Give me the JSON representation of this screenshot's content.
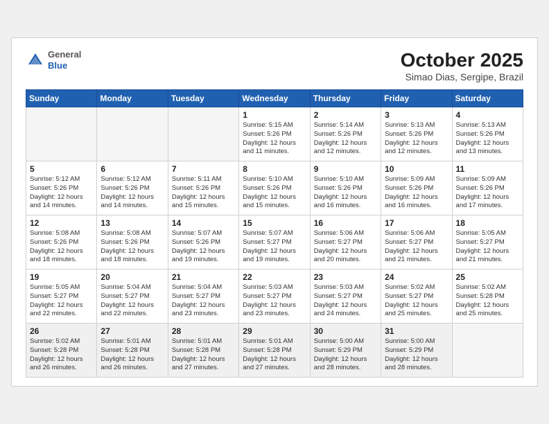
{
  "header": {
    "logo_general": "General",
    "logo_blue": "Blue",
    "month": "October 2025",
    "location": "Simao Dias, Sergipe, Brazil"
  },
  "days_of_week": [
    "Sunday",
    "Monday",
    "Tuesday",
    "Wednesday",
    "Thursday",
    "Friday",
    "Saturday"
  ],
  "weeks": [
    [
      {
        "day": "",
        "info": ""
      },
      {
        "day": "",
        "info": ""
      },
      {
        "day": "",
        "info": ""
      },
      {
        "day": "1",
        "info": "Sunrise: 5:15 AM\nSunset: 5:26 PM\nDaylight: 12 hours\nand 11 minutes."
      },
      {
        "day": "2",
        "info": "Sunrise: 5:14 AM\nSunset: 5:26 PM\nDaylight: 12 hours\nand 12 minutes."
      },
      {
        "day": "3",
        "info": "Sunrise: 5:13 AM\nSunset: 5:26 PM\nDaylight: 12 hours\nand 12 minutes."
      },
      {
        "day": "4",
        "info": "Sunrise: 5:13 AM\nSunset: 5:26 PM\nDaylight: 12 hours\nand 13 minutes."
      }
    ],
    [
      {
        "day": "5",
        "info": "Sunrise: 5:12 AM\nSunset: 5:26 PM\nDaylight: 12 hours\nand 14 minutes."
      },
      {
        "day": "6",
        "info": "Sunrise: 5:12 AM\nSunset: 5:26 PM\nDaylight: 12 hours\nand 14 minutes."
      },
      {
        "day": "7",
        "info": "Sunrise: 5:11 AM\nSunset: 5:26 PM\nDaylight: 12 hours\nand 15 minutes."
      },
      {
        "day": "8",
        "info": "Sunrise: 5:10 AM\nSunset: 5:26 PM\nDaylight: 12 hours\nand 15 minutes."
      },
      {
        "day": "9",
        "info": "Sunrise: 5:10 AM\nSunset: 5:26 PM\nDaylight: 12 hours\nand 16 minutes."
      },
      {
        "day": "10",
        "info": "Sunrise: 5:09 AM\nSunset: 5:26 PM\nDaylight: 12 hours\nand 16 minutes."
      },
      {
        "day": "11",
        "info": "Sunrise: 5:09 AM\nSunset: 5:26 PM\nDaylight: 12 hours\nand 17 minutes."
      }
    ],
    [
      {
        "day": "12",
        "info": "Sunrise: 5:08 AM\nSunset: 5:26 PM\nDaylight: 12 hours\nand 18 minutes."
      },
      {
        "day": "13",
        "info": "Sunrise: 5:08 AM\nSunset: 5:26 PM\nDaylight: 12 hours\nand 18 minutes."
      },
      {
        "day": "14",
        "info": "Sunrise: 5:07 AM\nSunset: 5:26 PM\nDaylight: 12 hours\nand 19 minutes."
      },
      {
        "day": "15",
        "info": "Sunrise: 5:07 AM\nSunset: 5:27 PM\nDaylight: 12 hours\nand 19 minutes."
      },
      {
        "day": "16",
        "info": "Sunrise: 5:06 AM\nSunset: 5:27 PM\nDaylight: 12 hours\nand 20 minutes."
      },
      {
        "day": "17",
        "info": "Sunrise: 5:06 AM\nSunset: 5:27 PM\nDaylight: 12 hours\nand 21 minutes."
      },
      {
        "day": "18",
        "info": "Sunrise: 5:05 AM\nSunset: 5:27 PM\nDaylight: 12 hours\nand 21 minutes."
      }
    ],
    [
      {
        "day": "19",
        "info": "Sunrise: 5:05 AM\nSunset: 5:27 PM\nDaylight: 12 hours\nand 22 minutes."
      },
      {
        "day": "20",
        "info": "Sunrise: 5:04 AM\nSunset: 5:27 PM\nDaylight: 12 hours\nand 22 minutes."
      },
      {
        "day": "21",
        "info": "Sunrise: 5:04 AM\nSunset: 5:27 PM\nDaylight: 12 hours\nand 23 minutes."
      },
      {
        "day": "22",
        "info": "Sunrise: 5:03 AM\nSunset: 5:27 PM\nDaylight: 12 hours\nand 23 minutes."
      },
      {
        "day": "23",
        "info": "Sunrise: 5:03 AM\nSunset: 5:27 PM\nDaylight: 12 hours\nand 24 minutes."
      },
      {
        "day": "24",
        "info": "Sunrise: 5:02 AM\nSunset: 5:27 PM\nDaylight: 12 hours\nand 25 minutes."
      },
      {
        "day": "25",
        "info": "Sunrise: 5:02 AM\nSunset: 5:28 PM\nDaylight: 12 hours\nand 25 minutes."
      }
    ],
    [
      {
        "day": "26",
        "info": "Sunrise: 5:02 AM\nSunset: 5:28 PM\nDaylight: 12 hours\nand 26 minutes."
      },
      {
        "day": "27",
        "info": "Sunrise: 5:01 AM\nSunset: 5:28 PM\nDaylight: 12 hours\nand 26 minutes."
      },
      {
        "day": "28",
        "info": "Sunrise: 5:01 AM\nSunset: 5:28 PM\nDaylight: 12 hours\nand 27 minutes."
      },
      {
        "day": "29",
        "info": "Sunrise: 5:01 AM\nSunset: 5:28 PM\nDaylight: 12 hours\nand 27 minutes."
      },
      {
        "day": "30",
        "info": "Sunrise: 5:00 AM\nSunset: 5:29 PM\nDaylight: 12 hours\nand 28 minutes."
      },
      {
        "day": "31",
        "info": "Sunrise: 5:00 AM\nSunset: 5:29 PM\nDaylight: 12 hours\nand 28 minutes."
      },
      {
        "day": "",
        "info": ""
      }
    ]
  ]
}
